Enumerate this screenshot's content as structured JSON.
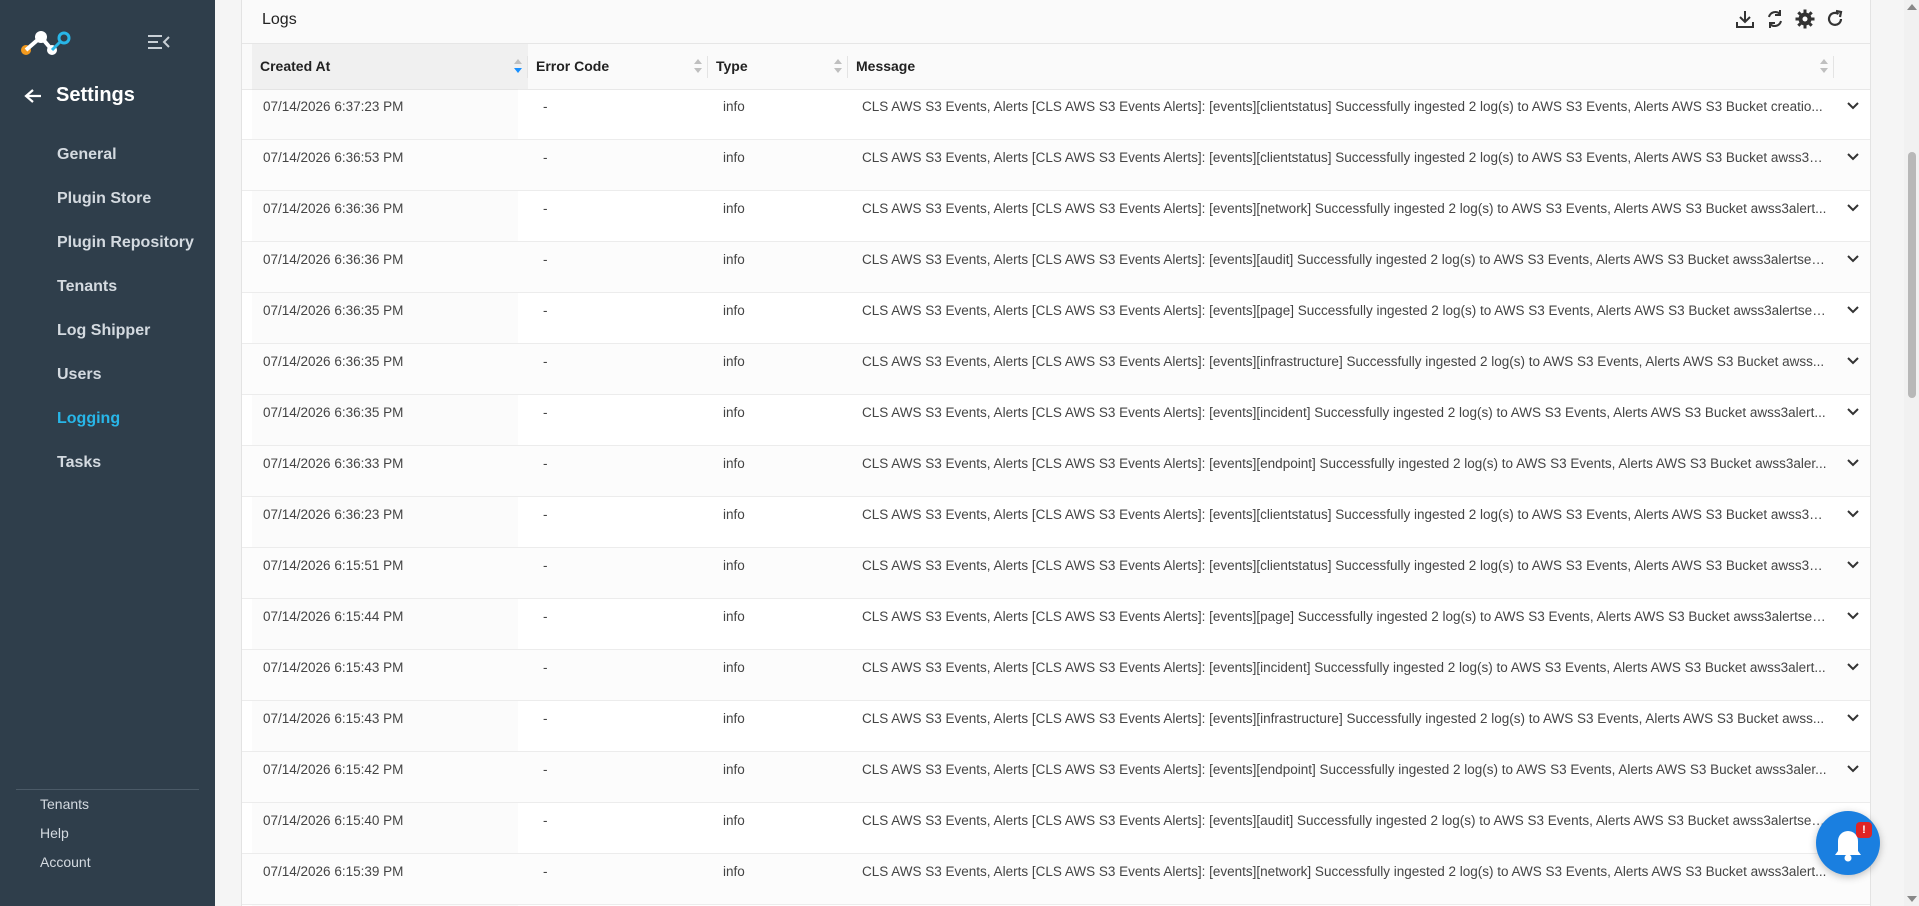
{
  "sidebar": {
    "title": "Settings",
    "items": [
      {
        "label": "General"
      },
      {
        "label": "Plugin Store"
      },
      {
        "label": "Plugin Repository"
      },
      {
        "label": "Tenants"
      },
      {
        "label": "Log Shipper"
      },
      {
        "label": "Users"
      },
      {
        "label": "Logging",
        "active": true
      },
      {
        "label": "Tasks"
      }
    ],
    "bottom": [
      {
        "label": "Tenants"
      },
      {
        "label": "Help"
      },
      {
        "label": "Account"
      }
    ],
    "accent_color": "#28b6e8"
  },
  "panel": {
    "title": "Logs",
    "tools": [
      "download-icon",
      "sync-icon",
      "gear-icon",
      "refresh-icon"
    ]
  },
  "table": {
    "columns": [
      "Created At",
      "Error Code",
      "Type",
      "Message"
    ],
    "rows": [
      {
        "created": "07/14/2026 6:37:23 PM",
        "code": "-",
        "type": "info",
        "message": "CLS AWS S3 Events, Alerts [CLS AWS S3 Events Alerts]: [events][clientstatus] Successfully ingested 2 log(s) to AWS S3 Events, Alerts AWS S3 Bucket creatio..."
      },
      {
        "created": "07/14/2026 6:36:53 PM",
        "code": "-",
        "type": "info",
        "message": "CLS AWS S3 Events, Alerts [CLS AWS S3 Events Alerts]: [events][clientstatus] Successfully ingested 2 log(s) to AWS S3 Events, Alerts AWS S3 Bucket awss3al..."
      },
      {
        "created": "07/14/2026 6:36:36 PM",
        "code": "-",
        "type": "info",
        "message": "CLS AWS S3 Events, Alerts [CLS AWS S3 Events Alerts]: [events][network] Successfully ingested 2 log(s) to AWS S3 Events, Alerts AWS S3 Bucket awss3alert..."
      },
      {
        "created": "07/14/2026 6:36:36 PM",
        "code": "-",
        "type": "info",
        "message": "CLS AWS S3 Events, Alerts [CLS AWS S3 Events Alerts]: [events][audit] Successfully ingested 2 log(s) to AWS S3 Events, Alerts AWS S3 Bucket awss3alertsev..."
      },
      {
        "created": "07/14/2026 6:36:35 PM",
        "code": "-",
        "type": "info",
        "message": "CLS AWS S3 Events, Alerts [CLS AWS S3 Events Alerts]: [events][page] Successfully ingested 2 log(s) to AWS S3 Events, Alerts AWS S3 Bucket awss3alertsev..."
      },
      {
        "created": "07/14/2026 6:36:35 PM",
        "code": "-",
        "type": "info",
        "message": "CLS AWS S3 Events, Alerts [CLS AWS S3 Events Alerts]: [events][infrastructure] Successfully ingested 2 log(s) to AWS S3 Events, Alerts AWS S3 Bucket awss..."
      },
      {
        "created": "07/14/2026 6:36:35 PM",
        "code": "-",
        "type": "info",
        "message": "CLS AWS S3 Events, Alerts [CLS AWS S3 Events Alerts]: [events][incident] Successfully ingested 2 log(s) to AWS S3 Events, Alerts AWS S3 Bucket awss3alert..."
      },
      {
        "created": "07/14/2026 6:36:33 PM",
        "code": "-",
        "type": "info",
        "message": "CLS AWS S3 Events, Alerts [CLS AWS S3 Events Alerts]: [events][endpoint] Successfully ingested 2 log(s) to AWS S3 Events, Alerts AWS S3 Bucket awss3aler..."
      },
      {
        "created": "07/14/2026 6:36:23 PM",
        "code": "-",
        "type": "info",
        "message": "CLS AWS S3 Events, Alerts [CLS AWS S3 Events Alerts]: [events][clientstatus] Successfully ingested 2 log(s) to AWS S3 Events, Alerts AWS S3 Bucket awss3al..."
      },
      {
        "created": "07/14/2026 6:15:51 PM",
        "code": "-",
        "type": "info",
        "message": "CLS AWS S3 Events, Alerts [CLS AWS S3 Events Alerts]: [events][clientstatus] Successfully ingested 2 log(s) to AWS S3 Events, Alerts AWS S3 Bucket awss3al..."
      },
      {
        "created": "07/14/2026 6:15:44 PM",
        "code": "-",
        "type": "info",
        "message": "CLS AWS S3 Events, Alerts [CLS AWS S3 Events Alerts]: [events][page] Successfully ingested 2 log(s) to AWS S3 Events, Alerts AWS S3 Bucket awss3alertsev..."
      },
      {
        "created": "07/14/2026 6:15:43 PM",
        "code": "-",
        "type": "info",
        "message": "CLS AWS S3 Events, Alerts [CLS AWS S3 Events Alerts]: [events][incident] Successfully ingested 2 log(s) to AWS S3 Events, Alerts AWS S3 Bucket awss3alert..."
      },
      {
        "created": "07/14/2026 6:15:43 PM",
        "code": "-",
        "type": "info",
        "message": "CLS AWS S3 Events, Alerts [CLS AWS S3 Events Alerts]: [events][infrastructure] Successfully ingested 2 log(s) to AWS S3 Events, Alerts AWS S3 Bucket awss..."
      },
      {
        "created": "07/14/2026 6:15:42 PM",
        "code": "-",
        "type": "info",
        "message": "CLS AWS S3 Events, Alerts [CLS AWS S3 Events Alerts]: [events][endpoint] Successfully ingested 2 log(s) to AWS S3 Events, Alerts AWS S3 Bucket awss3aler..."
      },
      {
        "created": "07/14/2026 6:15:40 PM",
        "code": "-",
        "type": "info",
        "message": "CLS AWS S3 Events, Alerts [CLS AWS S3 Events Alerts]: [events][audit] Successfully ingested 2 log(s) to AWS S3 Events, Alerts AWS S3 Bucket awss3alertsev..."
      },
      {
        "created": "07/14/2026 6:15:39 PM",
        "code": "-",
        "type": "info",
        "message": "CLS AWS S3 Events, Alerts [CLS AWS S3 Events Alerts]: [events][network] Successfully ingested 2 log(s) to AWS S3 Events, Alerts AWS S3 Bucket awss3alert..."
      }
    ]
  },
  "notification": {
    "badge": "!"
  }
}
